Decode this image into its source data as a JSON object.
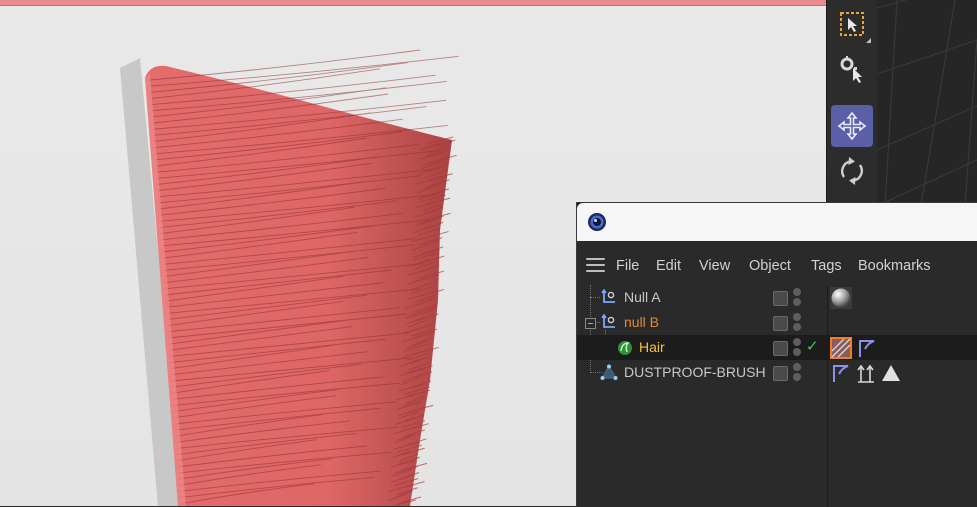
{
  "object_manager": {
    "menu": [
      "File",
      "Edit",
      "View",
      "Object",
      "Tags",
      "Bookmarks"
    ],
    "rows": [
      {
        "label": "Null A",
        "color": "#c8c8c8",
        "icon": "null-icon",
        "tags": [
          "material-tag-sphere"
        ]
      },
      {
        "label": "null B",
        "color": "#e0893a",
        "icon": "null-icon",
        "tags": []
      },
      {
        "label": "Hair",
        "color": "#f3c238",
        "icon": "hair-icon",
        "enabled_check": "✓",
        "tags": [
          "hair-material-tag",
          "phong-tag"
        ]
      },
      {
        "label": "DUSTPROOF-BRUSH",
        "color": "#c8c8c8",
        "icon": "polygon-object-icon",
        "tags": [
          "phong-tag",
          "normal-tag",
          "polygon-selection-tag"
        ]
      }
    ]
  },
  "toolbar": {
    "tools": [
      "select-rect-icon",
      "live-selection-icon",
      "move-icon",
      "rotate-icon"
    ],
    "active_tool": "move-icon"
  },
  "colors": {
    "bristle": "#e46d6d",
    "accent_active": "#5b5fa5",
    "label_default": "#c8c8c8",
    "label_orange": "#e0893a",
    "label_yellow": "#f3c238"
  }
}
